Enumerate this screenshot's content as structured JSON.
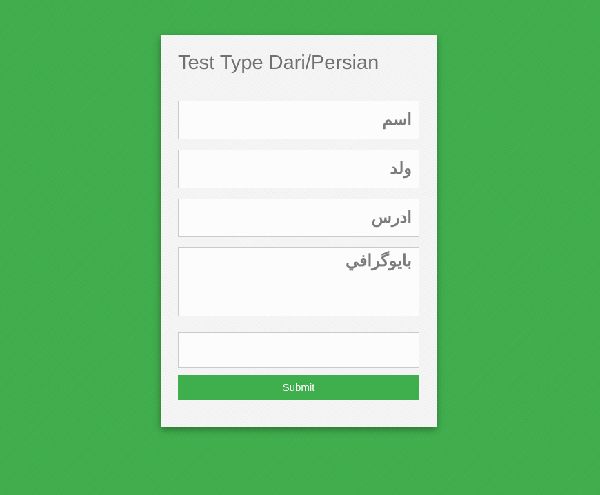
{
  "page": {
    "background_color": "#3fae4c",
    "card_color": "#f7f7f7"
  },
  "form": {
    "title": "Test Type Dari/Persian",
    "fields": {
      "name": {
        "placeholder": "اسم",
        "value": ""
      },
      "father_name": {
        "placeholder": "ولد",
        "value": ""
      },
      "address": {
        "placeholder": "ادرس",
        "value": ""
      },
      "biography": {
        "placeholder": "بایوگرافي",
        "value": ""
      },
      "extra": {
        "placeholder": "",
        "value": ""
      }
    },
    "submit_label": "Submit",
    "accent_color": "#3fae4c"
  }
}
